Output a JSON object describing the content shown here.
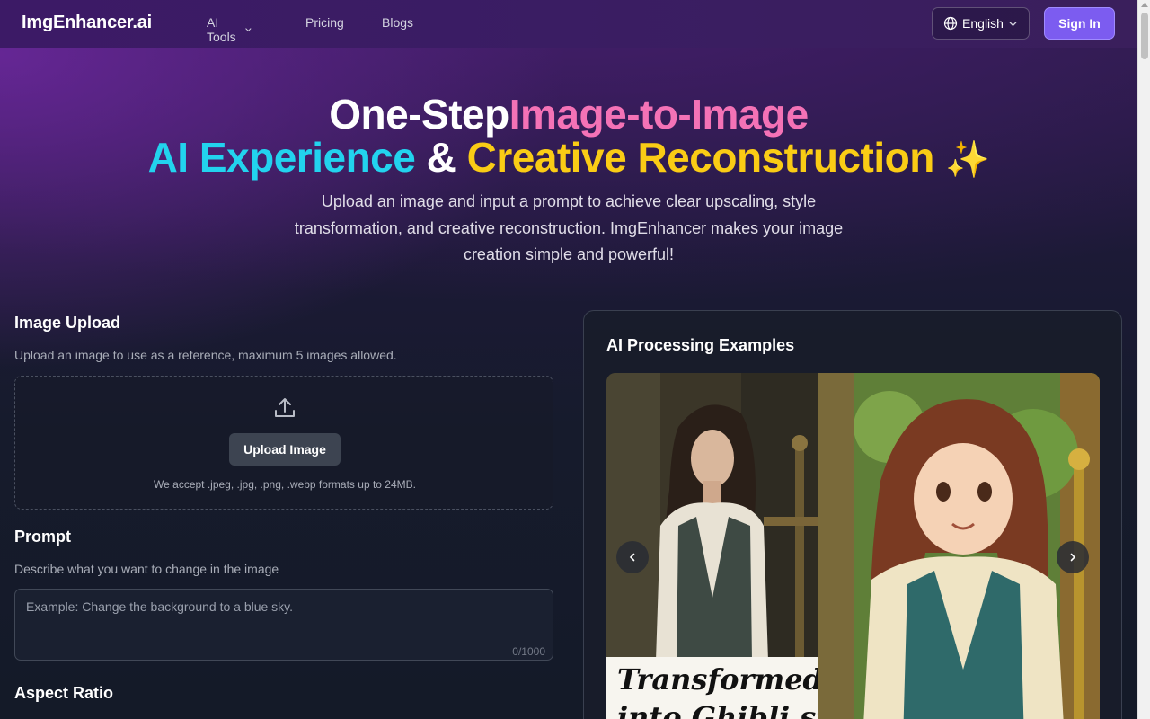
{
  "nav": {
    "logo": "ImgEnhancer.ai",
    "links": [
      {
        "label": "AI Tools",
        "has_dropdown": true
      },
      {
        "label": "Pricing"
      },
      {
        "label": "Blogs"
      }
    ],
    "language": "English",
    "sign_in": "Sign In"
  },
  "hero": {
    "line1_part1": "One-Step",
    "line1_part2": "Image-to-Image",
    "line2_part1": "AI Experience",
    "line2_part2": " & ",
    "line2_part3": "Creative Reconstruction",
    "line2_emoji": "✨",
    "subtitle_line1": "Upload an image and input a prompt to achieve clear upscaling, style",
    "subtitle_line2": "transformation, and creative reconstruction. ImgEnhancer makes your image",
    "subtitle_line3": "creation simple and powerful!"
  },
  "upload": {
    "title": "Image Upload",
    "description": "Upload an image to use as a reference, maximum 5 images allowed.",
    "button": "Upload Image",
    "note": "We accept .jpeg, .jpg, .png, .webp formats up to 24MB."
  },
  "prompt": {
    "title": "Prompt",
    "description": "Describe what you want to change in the image",
    "placeholder": "Example: Change the background to a blue sky.",
    "counter": "0/1000"
  },
  "aspect_ratio": {
    "title": "Aspect Ratio"
  },
  "examples": {
    "title": "AI Processing Examples",
    "caption_line1": "Transformed",
    "caption_line2": "into Ghibli style"
  },
  "colors": {
    "accent": "#7c5cf0",
    "pink": "#f472b6",
    "cyan": "#22d3ee",
    "yellow": "#facc15"
  }
}
